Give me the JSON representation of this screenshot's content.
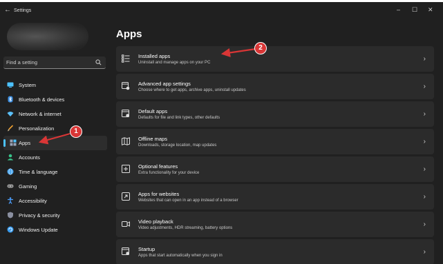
{
  "window": {
    "title": "Settings",
    "back_glyph": "←",
    "minimize_glyph": "–",
    "maximize_glyph": "☐",
    "close_glyph": "✕"
  },
  "search": {
    "placeholder": "Find a setting",
    "icon": "search-icon"
  },
  "sidebar": {
    "items": [
      {
        "label": "System",
        "icon": "system-icon",
        "color": "#4cc2ff",
        "selected": false
      },
      {
        "label": "Bluetooth & devices",
        "icon": "bluetooth-icon",
        "color": "#3a8de0",
        "selected": false
      },
      {
        "label": "Network & internet",
        "icon": "network-icon",
        "color": "#5bc0f8",
        "selected": false
      },
      {
        "label": "Personalization",
        "icon": "brush-icon",
        "color": "#f0a030",
        "selected": false
      },
      {
        "label": "Apps",
        "icon": "apps-icon",
        "color": "#9aa4b8",
        "selected": true
      },
      {
        "label": "Accounts",
        "icon": "person-icon",
        "color": "#38c38a",
        "selected": false
      },
      {
        "label": "Time & language",
        "icon": "globe-icon",
        "color": "#4ca8f0",
        "selected": false
      },
      {
        "label": "Gaming",
        "icon": "gamepad-icon",
        "color": "#a0a0a0",
        "selected": false
      },
      {
        "label": "Accessibility",
        "icon": "accessibility-icon",
        "color": "#4ca0ff",
        "selected": false
      },
      {
        "label": "Privacy & security",
        "icon": "shield-icon",
        "color": "#8a8fa0",
        "selected": false
      },
      {
        "label": "Windows Update",
        "icon": "update-icon",
        "color": "#3a9df0",
        "selected": false
      }
    ]
  },
  "main": {
    "heading": "Apps",
    "cards": [
      {
        "title": "Installed apps",
        "desc": "Uninstall and manage apps on your PC",
        "icon": "list-icon"
      },
      {
        "title": "Advanced app settings",
        "desc": "Choose where to get apps, archive apps, uninstall updates",
        "icon": "app-settings-icon"
      },
      {
        "title": "Default apps",
        "desc": "Defaults for file and link types, other defaults",
        "icon": "default-apps-icon"
      },
      {
        "title": "Offline maps",
        "desc": "Downloads, storage location, map updates",
        "icon": "map-icon"
      },
      {
        "title": "Optional features",
        "desc": "Extra functionality for your device",
        "icon": "add-feature-icon"
      },
      {
        "title": "Apps for websites",
        "desc": "Websites that can open in an app instead of a browser",
        "icon": "web-app-icon"
      },
      {
        "title": "Video playback",
        "desc": "Video adjustments, HDR streaming, battery options",
        "icon": "video-icon"
      },
      {
        "title": "Startup",
        "desc": "Apps that start automatically when you sign in",
        "icon": "startup-icon"
      }
    ],
    "chevron": "›"
  },
  "annotations": [
    {
      "label": "1",
      "color": "#d93636"
    },
    {
      "label": "2",
      "color": "#d93636"
    }
  ]
}
